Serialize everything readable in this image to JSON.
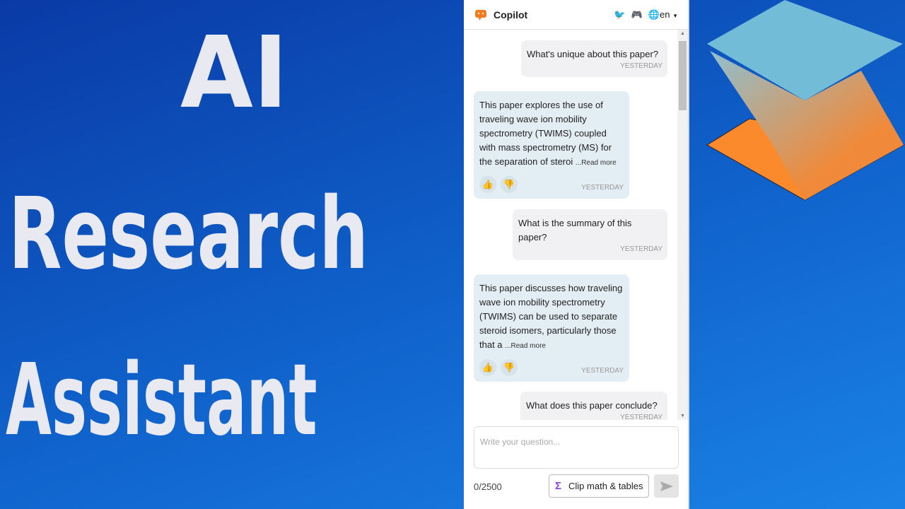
{
  "title_lines": [
    "AI",
    "Research",
    "Assistant"
  ],
  "panel": {
    "app_name": "Copilot",
    "language": "en",
    "messages": [
      {
        "role": "user",
        "text": "What's unique about this paper?",
        "time": "YESTERDAY"
      },
      {
        "role": "bot",
        "text": "This paper explores the use of traveling wave ion mobility spectrometry (TWIMS) coupled with mass spectrometry (MS) for the separation of steroi",
        "more": "...Read more",
        "time": "YESTERDAY"
      },
      {
        "role": "user",
        "text": "What is the summary of this paper?",
        "time": "YESTERDAY"
      },
      {
        "role": "bot",
        "text": "This paper discusses how traveling wave ion mobility spectrometry (TWIMS) can be used to separate steroid isomers, particularly those that a",
        "more": "...Read more",
        "time": "YESTERDAY"
      },
      {
        "role": "user",
        "text": "What does this paper conclude?",
        "time": "YESTERDAY"
      }
    ],
    "input_placeholder": "Write your question...",
    "char_count": "0/2500",
    "clip_label": "Clip math & tables"
  },
  "colors": {
    "accent": "#f47c20",
    "sigma": "#8a3fe0",
    "bot_bubble": "#e3eef4",
    "user_bubble": "#f1f1f3"
  }
}
